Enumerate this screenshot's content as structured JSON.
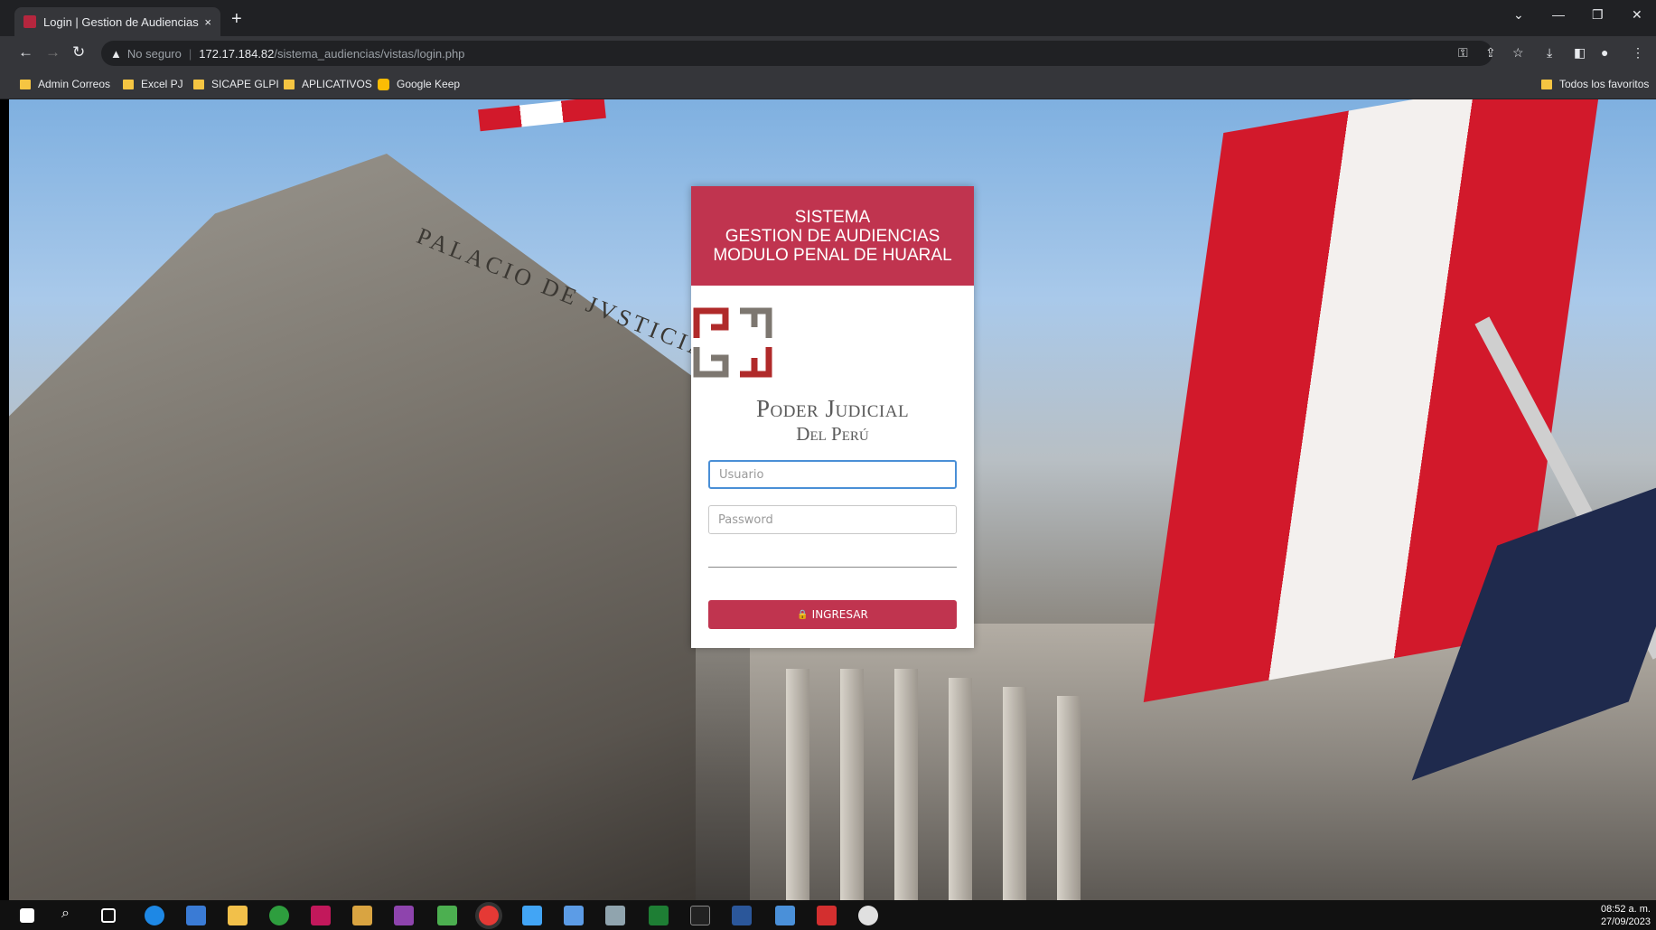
{
  "browser": {
    "tab_title": "Login | Gestion de Audiencias",
    "tab_close": "×",
    "new_tab": "+",
    "security_label": "No seguro",
    "url_host": "172.17.184.82",
    "url_path": "/sistema_audiencias/vistas/login.php",
    "bookmarks": [
      "Admin Correos",
      "Excel PJ",
      "SICAPE GLPI",
      "APLICATIVOS",
      "Google Keep"
    ],
    "all_bookmarks": "Todos los favoritos"
  },
  "background": {
    "engraving": "PALACIO DE JVSTICIA"
  },
  "login": {
    "header_line1": "SISTEMA",
    "header_line2": "GESTION DE AUDIENCIAS",
    "header_line3": "MODULO PENAL DE HUARAL",
    "org_line1": "Poder Judicial",
    "org_line2": "Del Perú",
    "user_placeholder": "Usuario",
    "password_placeholder": "Password",
    "submit_label": "INGRESAR"
  },
  "colors": {
    "accent": "#c0344f",
    "logo_red": "#b02a2a",
    "logo_gray": "#7d7770"
  },
  "taskbar": {
    "time": "08:52 a. m.",
    "date": "27/09/2023"
  }
}
